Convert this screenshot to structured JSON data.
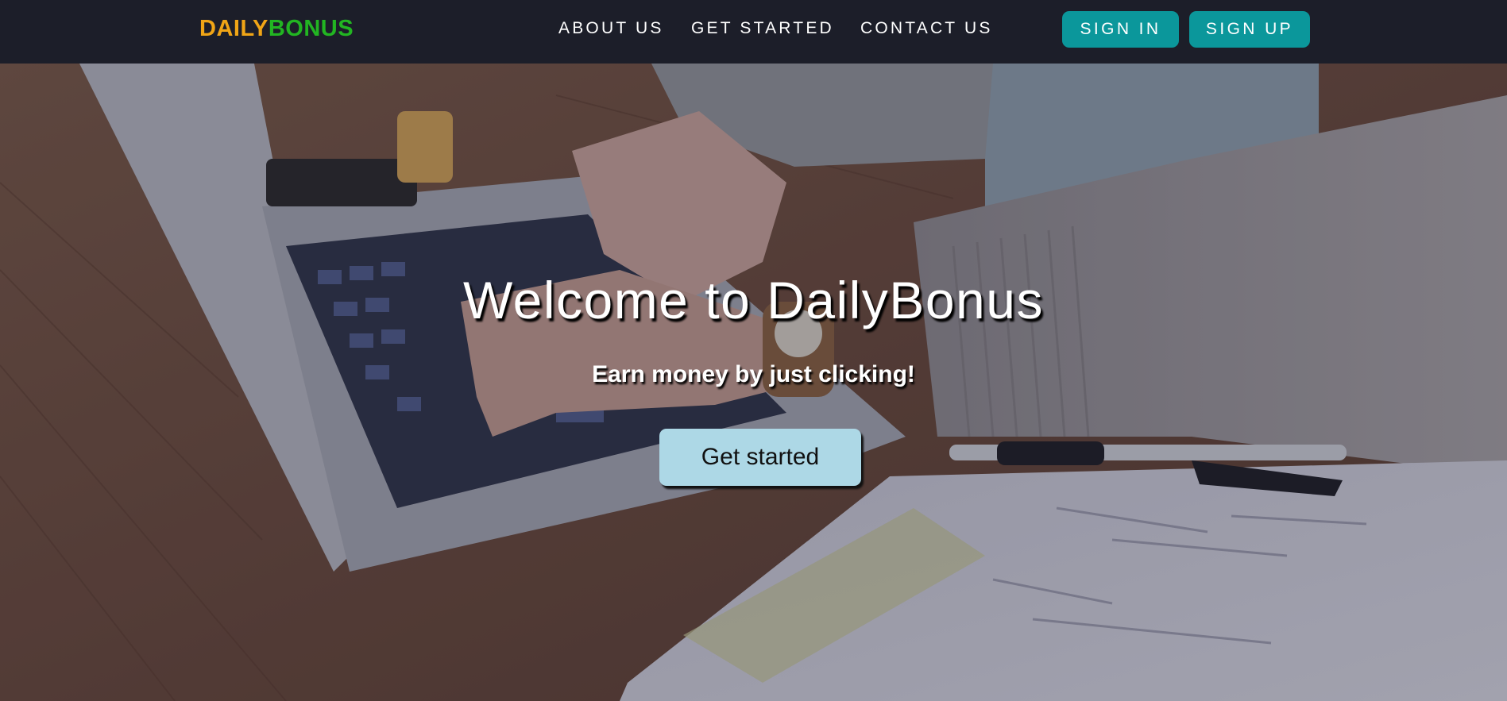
{
  "brand": {
    "part1": "DAILY",
    "part2": "BONUS",
    "color1": "#f0a516",
    "color2": "#22b522"
  },
  "nav": {
    "links": [
      "ABOUT US",
      "GET STARTED",
      "CONTACT US"
    ],
    "sign_in": "SIGN IN",
    "sign_up": "SIGN UP",
    "button_color": "#0b979b",
    "bar_color": "#1c1e29"
  },
  "hero": {
    "title": "Welcome to DailyBonus",
    "subtitle": "Earn money by just clicking!",
    "cta": "Get started",
    "cta_color": "#add8e6",
    "background_image": "laptop-typing-photo"
  }
}
